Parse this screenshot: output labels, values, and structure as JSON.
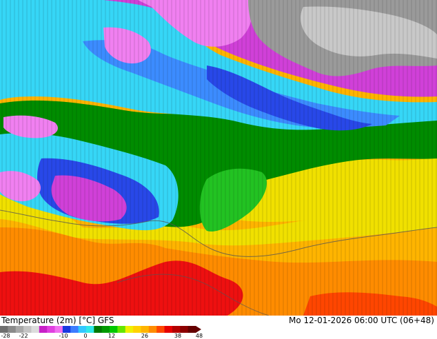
{
  "footer": {
    "title": "Temperature (2m) [°C] GFS",
    "timestamp": "Mo 12-01-2026 06:00 UTC (06+48)"
  },
  "colorbar": {
    "ticks": [
      "-28",
      "-22",
      "-10",
      "0",
      "12",
      "26",
      "38",
      "48"
    ],
    "colors": [
      "#6e6e6e",
      "#8a8a8a",
      "#a8a8a8",
      "#c4c4c4",
      "#dcdcdc",
      "#c820c8",
      "#e040e0",
      "#f070f0",
      "#1838e0",
      "#3c7cff",
      "#32c8ff",
      "#30e8e8",
      "#007800",
      "#009a00",
      "#00c800",
      "#64e600",
      "#f0f000",
      "#ffd200",
      "#ffb400",
      "#ff8c00",
      "#ff4600",
      "#e60000",
      "#b40000",
      "#8c0000",
      "#640000"
    ]
  },
  "map": {
    "palette": {
      "gray": "#9a9a9a",
      "light_gray": "#c8c8c8",
      "magenta": "#d040d8",
      "pink": "#f080f0",
      "blue": "#2848e8",
      "light_blue": "#3c8cff",
      "cyan": "#36d6f6",
      "green": "#008c00",
      "bright_green": "#22c222",
      "yellow": "#f0e000",
      "orange_yellow": "#ffc400",
      "orange": "#ff9a00",
      "red": "#ee1010"
    }
  }
}
